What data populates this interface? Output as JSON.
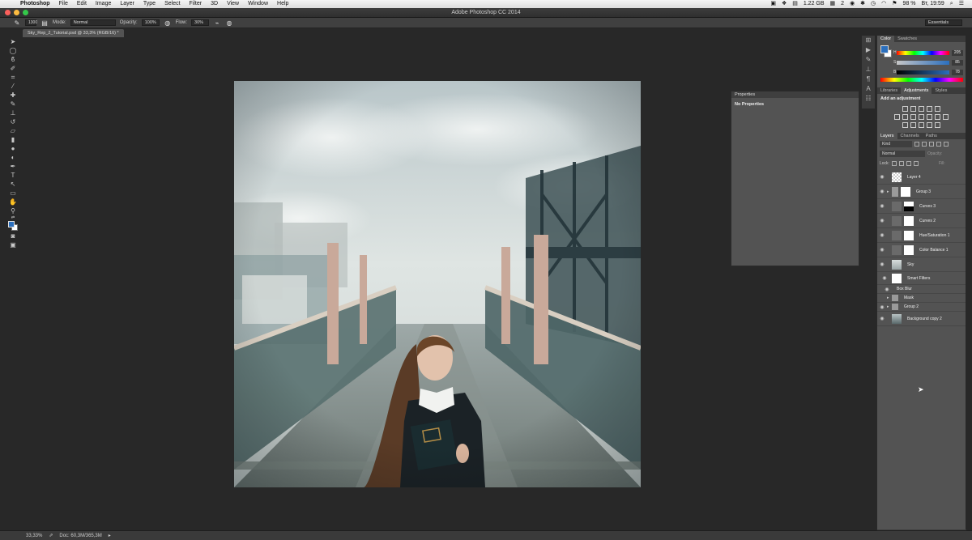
{
  "menubar": {
    "app": "Photoshop",
    "items": [
      "File",
      "Edit",
      "Image",
      "Layer",
      "Type",
      "Select",
      "Filter",
      "3D",
      "View",
      "Window",
      "Help"
    ],
    "status": {
      "memory": "1.22 GB",
      "badge": "2",
      "battery": "98 %",
      "datetime": "Вт, 19:59"
    }
  },
  "window": {
    "title": "Adobe Photoshop CC 2014"
  },
  "options": {
    "brush_size": "1300",
    "mode_label": "Mode:",
    "mode_value": "Normal",
    "opacity_label": "Opacity:",
    "opacity_value": "100%",
    "flow_label": "Flow:",
    "flow_value": "30%",
    "workspace": "Essentials"
  },
  "document": {
    "tab": "Sky_Rep_2_Tutorial.psd @ 33,3% (RGB/16) *"
  },
  "statusbar": {
    "zoom": "33,33%",
    "doc": "Doc: 60,3M/365,3M"
  },
  "properties": {
    "title": "Properties",
    "content": "No Properties"
  },
  "color_panel": {
    "tabs": [
      "Color",
      "Swatches"
    ],
    "h": {
      "label": "H",
      "value": "205"
    },
    "s": {
      "label": "S",
      "value": "85"
    },
    "b": {
      "label": "B",
      "value": "78"
    },
    "foreground": "#2b6fbd",
    "background": "#ffffff"
  },
  "adjustments": {
    "tabs": [
      "Libraries",
      "Adjustments",
      "Styles"
    ],
    "title": "Add an adjustment"
  },
  "layers": {
    "tabs": [
      "Layers",
      "Channels",
      "Paths"
    ],
    "filter": "Kind",
    "blend": "Normal",
    "opacity_label": "Opacity:",
    "lock_label": "Lock:",
    "fill_label": "Fill:",
    "items": [
      {
        "name": "Layer 4"
      },
      {
        "name": "Group 3"
      },
      {
        "name": "Curves 3"
      },
      {
        "name": "Curves 2"
      },
      {
        "name": "Hue/Saturation 1"
      },
      {
        "name": "Color Balance 1"
      },
      {
        "name": "Sky"
      },
      {
        "name": "Smart Filters"
      },
      {
        "name": "Box Blur"
      },
      {
        "name": "Mask"
      },
      {
        "name": "Group 2"
      },
      {
        "name": "Background copy 2"
      }
    ]
  }
}
